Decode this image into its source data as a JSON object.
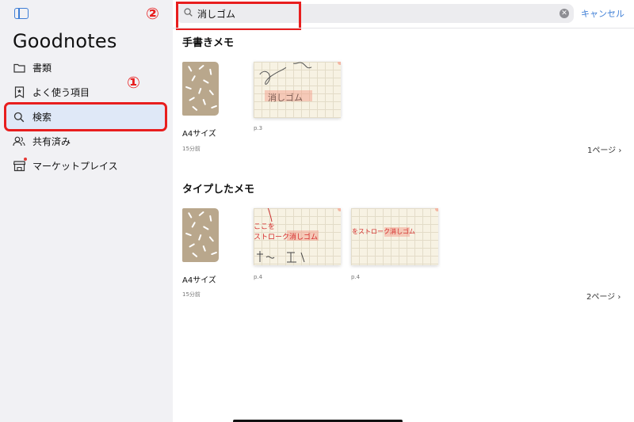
{
  "app": {
    "title": "Goodnotes"
  },
  "sidebar": {
    "items": [
      {
        "label": "書類",
        "icon": "folder-icon"
      },
      {
        "label": "よく使う項目",
        "icon": "bookmark-star-icon"
      },
      {
        "label": "検索",
        "icon": "search-icon",
        "active": true
      },
      {
        "label": "共有済み",
        "icon": "people-icon"
      },
      {
        "label": "マーケットプレイス",
        "icon": "store-icon",
        "badge": true
      }
    ]
  },
  "search": {
    "query": "消しゴム",
    "cancel_label": "キャンセル"
  },
  "callouts": {
    "one": "①",
    "two": "②"
  },
  "sections": [
    {
      "title": "手書きメモ",
      "doc_name": "A4サイズ",
      "time": "15分前",
      "pages_label": "1ページ",
      "results": [
        {
          "page": "p.3",
          "snippet": "消しゴム"
        }
      ]
    },
    {
      "title": "タイプしたメモ",
      "doc_name": "A4サイズ",
      "time": "15分前",
      "pages_label": "2ページ",
      "results": [
        {
          "page": "p.4",
          "snippet_lines": [
            "ここを",
            "ストローク消しゴム"
          ]
        },
        {
          "page": "p.4",
          "snippet": "をストローク消しゴム"
        }
      ]
    }
  ],
  "colors": {
    "accent": "#3f7fd6",
    "callout": "#e81e1e",
    "sidebar_bg": "#f1f1f4"
  }
}
